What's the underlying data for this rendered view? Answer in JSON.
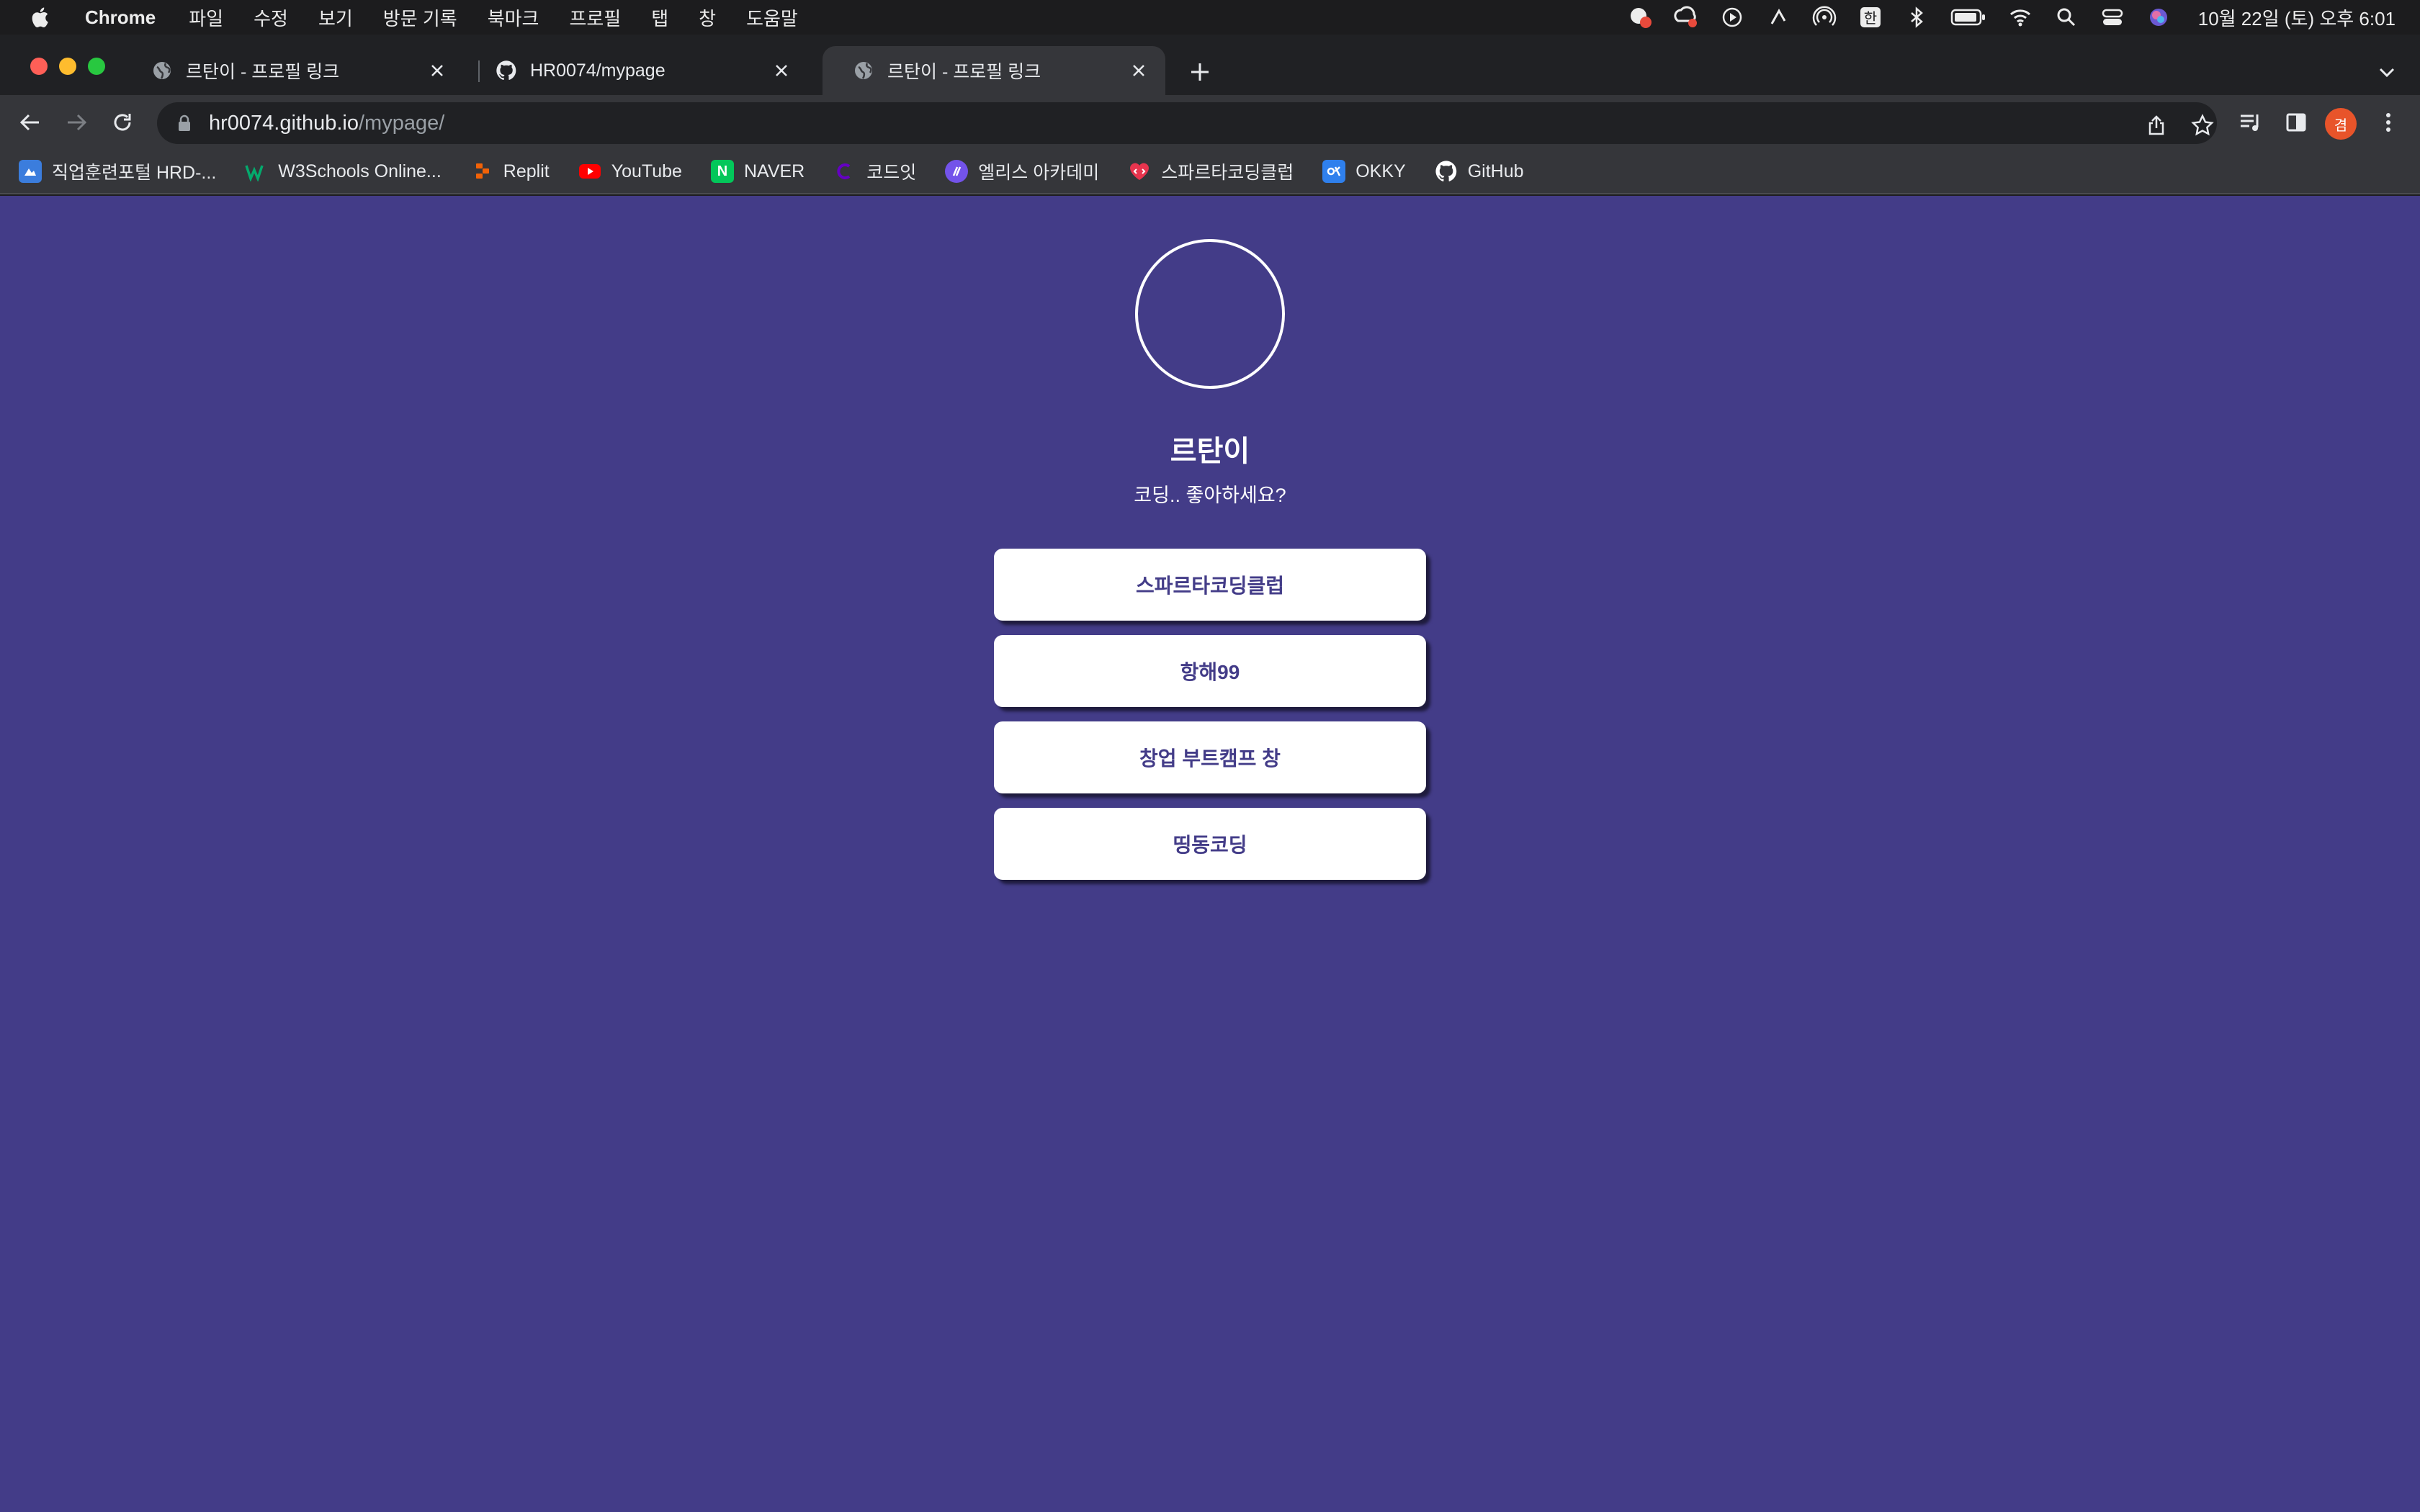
{
  "menubar": {
    "app_name": "Chrome",
    "items": [
      "파일",
      "수정",
      "보기",
      "방문 기록",
      "북마크",
      "프로필",
      "탭",
      "창",
      "도움말"
    ],
    "clock": "10월 22일 (토) 오후 6:01"
  },
  "tabs": [
    {
      "title": "르탄이 - 프로필 링크",
      "icon": "globe-icon",
      "active": false
    },
    {
      "title": "HR0074/mypage",
      "icon": "github-icon",
      "active": false
    },
    {
      "title": "르탄이 - 프로필 링크",
      "icon": "globe-icon",
      "active": true
    }
  ],
  "address_bar": {
    "host": "hr0074.github.io",
    "path": "/mypage/"
  },
  "profile_avatar_letter": "겸",
  "bookmarks": [
    {
      "label": "직업훈련포털 HRD-...",
      "icon": "hrd-icon",
      "color": "#3b7ddd"
    },
    {
      "label": "W3Schools Online...",
      "icon": "w3schools-icon",
      "color": "#04aa6d"
    },
    {
      "label": "Replit",
      "icon": "replit-icon",
      "color": "#f26207"
    },
    {
      "label": "YouTube",
      "icon": "youtube-icon",
      "color": "#ff0000"
    },
    {
      "label": "NAVER",
      "icon": "naver-icon",
      "color": "#03c75a"
    },
    {
      "label": "코드잇",
      "icon": "codeit-icon",
      "color": "#6500c3"
    },
    {
      "label": "엘리스 아카데미",
      "icon": "elice-icon",
      "color": "#7353ea"
    },
    {
      "label": "스파르타코딩클럽",
      "icon": "sparta-icon",
      "color": "#e8344e"
    },
    {
      "label": "OKKY",
      "icon": "okky-icon",
      "color": "#2f80ed"
    },
    {
      "label": "GitHub",
      "icon": "github-icon",
      "color": "#ffffff"
    }
  ],
  "page": {
    "background": "#433c88",
    "name": "르탄이",
    "bio": "코딩.. 좋아하세요?",
    "links": [
      "스파르타코딩클럽",
      "항해99",
      "창업 부트캠프 창",
      "띵동코딩"
    ]
  }
}
